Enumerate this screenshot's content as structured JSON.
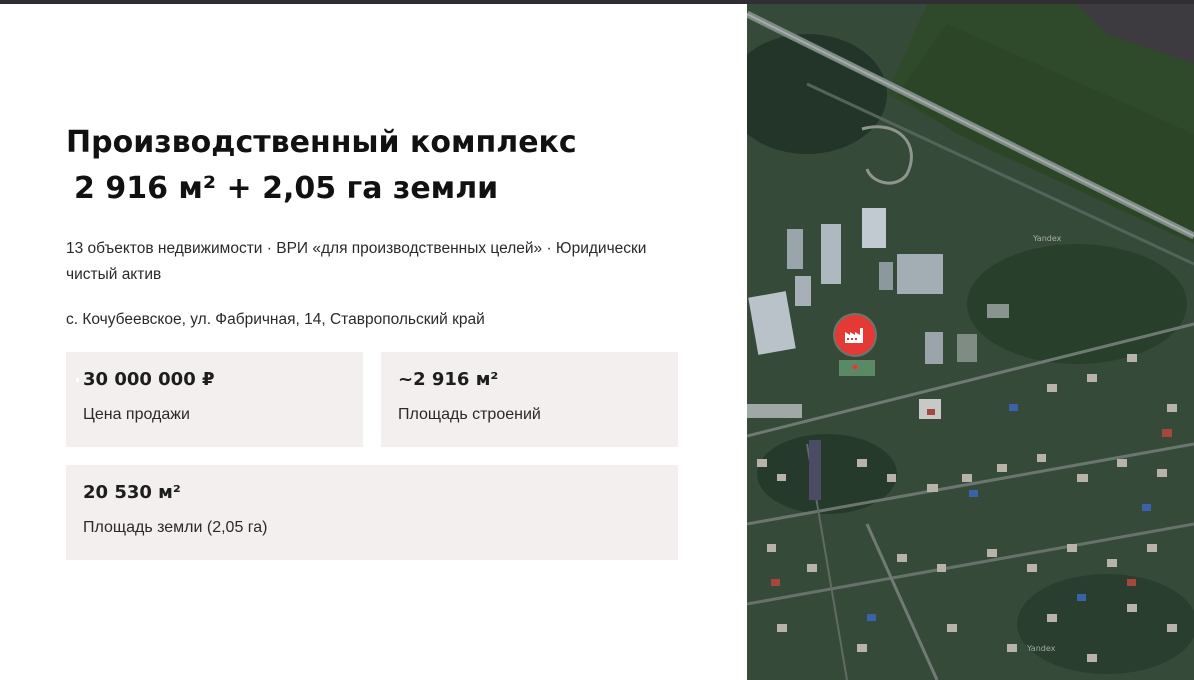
{
  "listing": {
    "title_line1": "Производственный комплекс",
    "title_line2": "2 916 м² + 2,05 га земли",
    "subtitle": "13 объектов недвижимости · ВРИ «для производственных целей» · Юридически чистый актив",
    "address": "с. Кочубеевское, ул. Фабричная, 14, Ставропольский край"
  },
  "cards": [
    {
      "value": "30 000 000 ₽",
      "label": "Цена продажи"
    },
    {
      "value": "~2 916 м²",
      "label": "Площадь строений"
    },
    {
      "value": "20 530 м²",
      "label": "Площадь земли (2,05 га)"
    }
  ],
  "map": {
    "watermarks": [
      "Yandex",
      "Yandex"
    ],
    "marker_icon": "factory-icon",
    "colors": {
      "marker": "#e53935",
      "card_bg": "#f2efee",
      "top_bar": "#2f2f33"
    }
  }
}
